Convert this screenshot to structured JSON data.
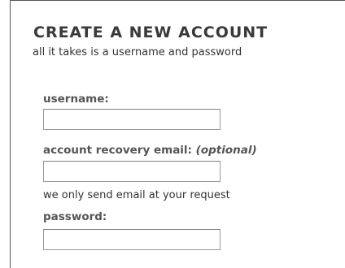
{
  "form": {
    "title": "CREATE A NEW ACCOUNT",
    "subtitle": "all it takes is a username and password",
    "username": {
      "label": "username:",
      "value": ""
    },
    "recovery_email": {
      "label": "account recovery email:",
      "optional_text": "(optional)",
      "value": "",
      "note": "we only send email at your request"
    },
    "password": {
      "label": "password:",
      "value": ""
    }
  }
}
